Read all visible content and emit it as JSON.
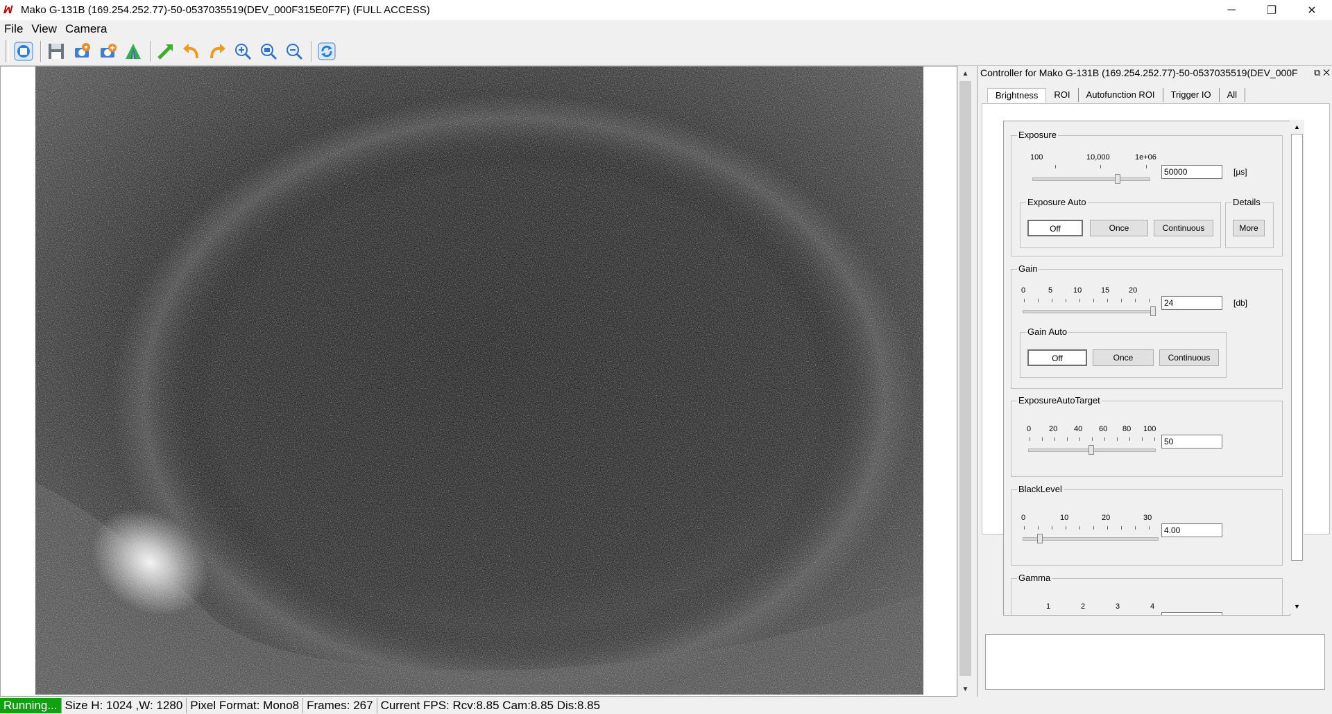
{
  "window": {
    "title": "Mako G-131B (169.254.252.77)-50-0537035519(DEV_000F315E0F7F) (FULL ACCESS)",
    "minimize": "─",
    "maximize": "❐",
    "close": "✕"
  },
  "menu": [
    "File",
    "View",
    "Camera"
  ],
  "toolbar": [
    "start-stop-icon",
    "save-icon",
    "camera-settings-icon",
    "camera-settings-alt-icon",
    "histogram-icon",
    "full-size-icon",
    "undo-icon",
    "redo-icon",
    "zoom-in-icon",
    "zoom-fit-icon",
    "zoom-out-icon",
    "refresh-icon"
  ],
  "controller": {
    "title": "Controller for Mako G-131B (169.254.252.77)-50-0537035519(DEV_000F",
    "tabs": [
      "Brightness",
      "ROI",
      "Autofunction ROI",
      "Trigger IO",
      "All"
    ],
    "exposure": {
      "label": "Exposure",
      "ticks": [
        "100",
        "10,000",
        "1e+06"
      ],
      "value": "50000",
      "unit": "[µs]",
      "level": 0.73
    },
    "exposure_auto": {
      "label": "Exposure Auto",
      "buttons": [
        "Off",
        "Once",
        "Continuous"
      ],
      "selected": "Off"
    },
    "details": {
      "label": "Details",
      "button": "More"
    },
    "gain": {
      "label": "Gain",
      "ticks": [
        "0",
        "5",
        "10",
        "15",
        "20"
      ],
      "value": "24",
      "unit": "[db]",
      "level": 1.0
    },
    "gain_auto": {
      "label": "Gain Auto",
      "buttons": [
        "Off",
        "Once",
        "Continuous"
      ],
      "selected": "Off"
    },
    "exposure_auto_target": {
      "label": "ExposureAutoTarget",
      "ticks": [
        "0",
        "20",
        "40",
        "60",
        "80",
        "100"
      ],
      "value": "50",
      "level": 0.5
    },
    "black_level": {
      "label": "BlackLevel",
      "ticks": [
        "0",
        "10",
        "20",
        "30"
      ],
      "value": "4.00",
      "level": 0.13
    },
    "gamma": {
      "label": "Gamma",
      "ticks": [
        "1",
        "2",
        "3",
        "4"
      ]
    }
  },
  "status": {
    "running": "Running...",
    "size": "Size H: 1024 ,W: 1280",
    "pixel_format": "Pixel Format: Mono8",
    "frames": "Frames: 267",
    "fps": "Current FPS: Rcv:8.85 Cam:8.85 Dis:8.85"
  },
  "colors": {
    "running_bg": "#12a012"
  }
}
